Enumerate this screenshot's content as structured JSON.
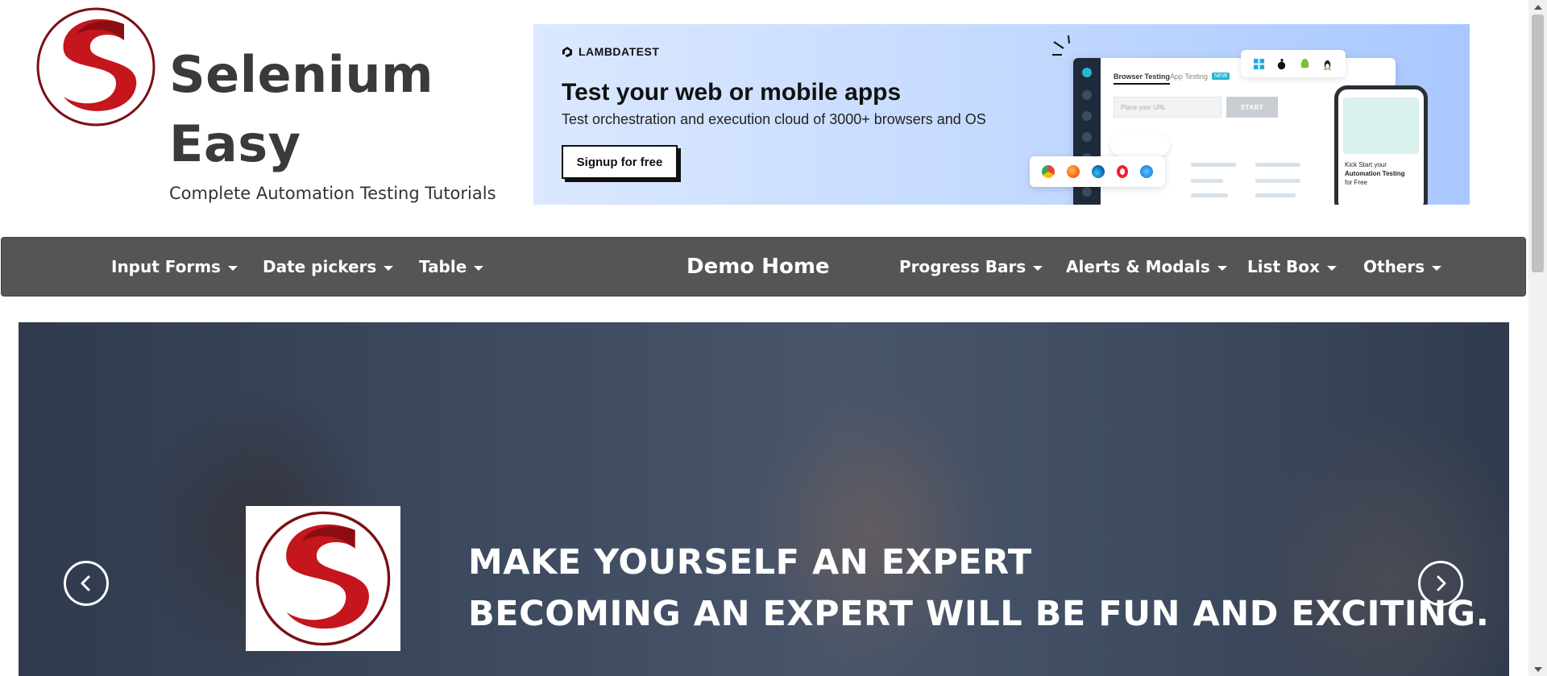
{
  "brand": {
    "title_line1": "Selenium",
    "title_line2": "Easy",
    "subtitle": "Complete Automation Testing Tutorials"
  },
  "ad": {
    "logo_text": "LAMBDATEST",
    "headline": "Test your web or mobile apps",
    "tagline": "Test orchestration and execution cloud of 3000+ browsers and OS",
    "cta": "Signup for free",
    "mock_tab_browser": "Browser Testing",
    "mock_tab_app": "App Testing",
    "mock_badge": "NEW",
    "mock_url_placeholder": "Place your URL",
    "mock_start": "START",
    "phone_line1": "Kick Start your",
    "phone_line2": "Automation Testing",
    "phone_line3": "for Free"
  },
  "nav": {
    "items": [
      {
        "label": "Input Forms"
      },
      {
        "label": "Date pickers"
      },
      {
        "label": "Table"
      },
      {
        "label": "Demo Home"
      },
      {
        "label": "Progress Bars"
      },
      {
        "label": "Alerts & Modals"
      },
      {
        "label": "List Box"
      },
      {
        "label": "Others"
      }
    ]
  },
  "hero": {
    "line1": "MAKE YOURSELF AN EXPERT",
    "line2": "BECOMING AN EXPERT WILL BE FUN AND EXCITING."
  },
  "colors": {
    "nav_bg": "#555555",
    "brand_red": "#c4161c",
    "brand_text": "#3a3a3a"
  }
}
